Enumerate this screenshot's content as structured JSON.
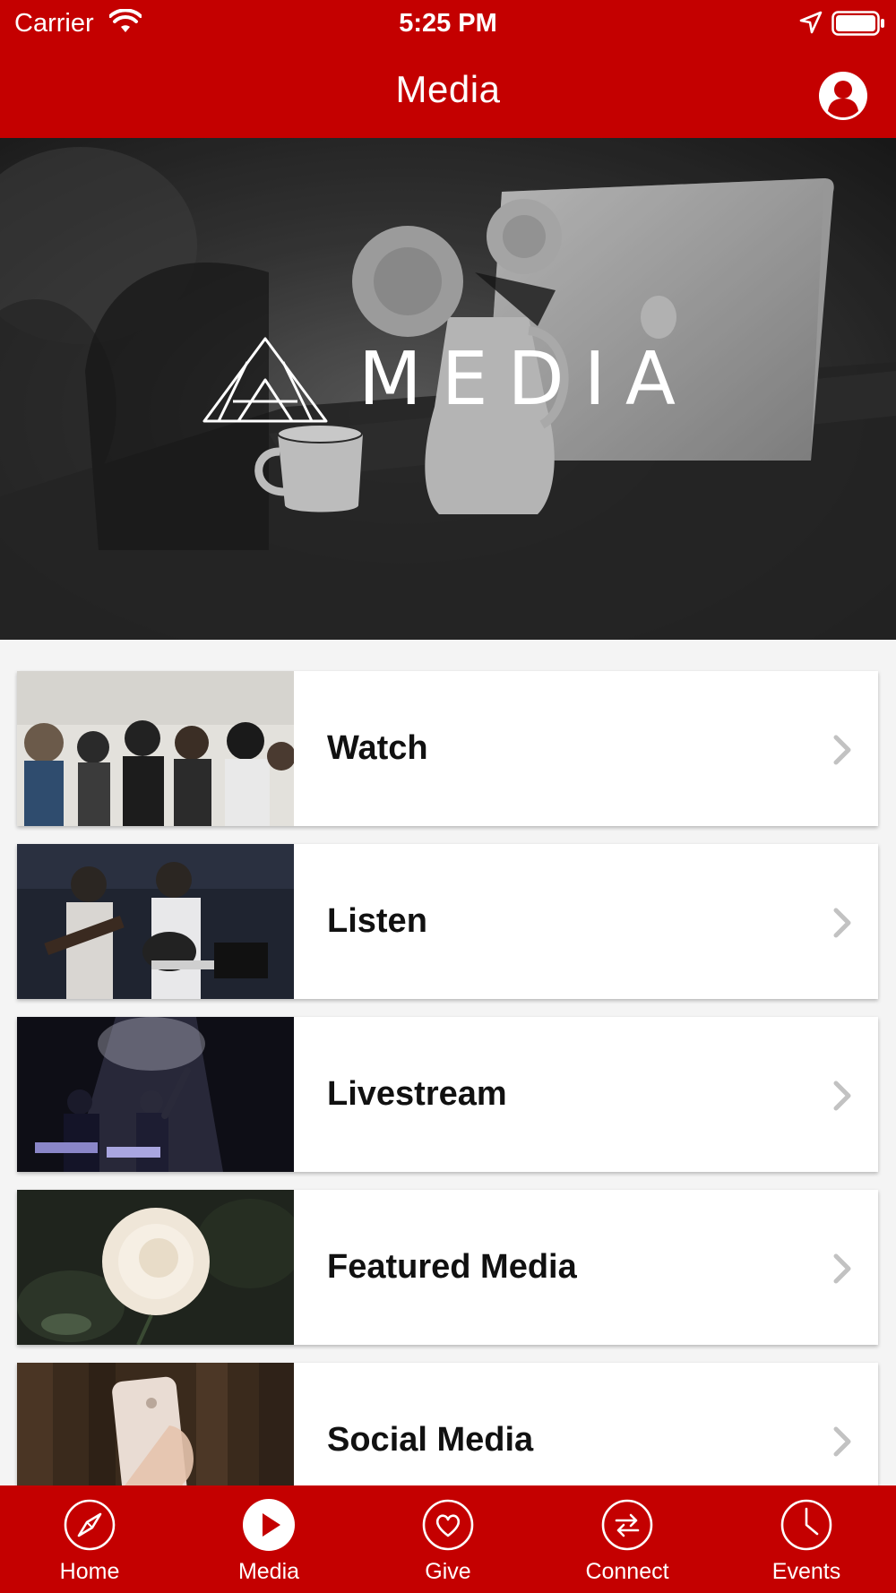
{
  "status_bar": {
    "carrier": "Carrier",
    "time": "5:25 PM"
  },
  "header": {
    "title": "Media"
  },
  "hero": {
    "title": "MEDIA"
  },
  "menu": {
    "items": [
      {
        "label": "Watch"
      },
      {
        "label": "Listen"
      },
      {
        "label": "Livestream"
      },
      {
        "label": "Featured Media"
      },
      {
        "label": "Social Media"
      }
    ]
  },
  "tabs": [
    {
      "label": "Home",
      "icon": "compass-icon",
      "active": false
    },
    {
      "label": "Media",
      "icon": "play-icon",
      "active": true
    },
    {
      "label": "Give",
      "icon": "heart-icon",
      "active": false
    },
    {
      "label": "Connect",
      "icon": "arrows-exchange-icon",
      "active": false
    },
    {
      "label": "Events",
      "icon": "clock-icon",
      "active": false
    }
  ],
  "colors": {
    "brand": "#c40000",
    "background": "#f4f4f4",
    "card": "#ffffff"
  }
}
